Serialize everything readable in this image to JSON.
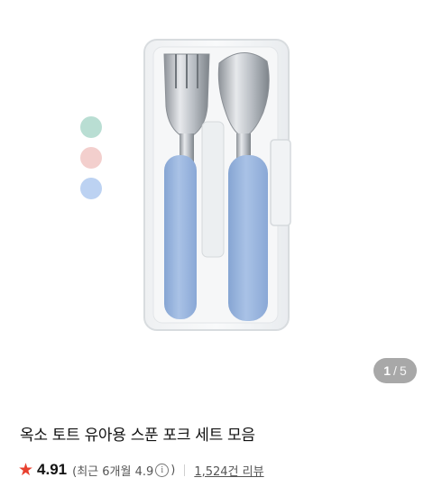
{
  "product": {
    "title": "옥소 토트 유아용 스푼 포크 세트 모음",
    "image_alt": "OXO tot spoon and fork set in case"
  },
  "color_options": [
    {
      "name": "mint",
      "color": "#b9ded3"
    },
    {
      "name": "pink",
      "color": "#f3cfcd"
    },
    {
      "name": "blue",
      "color": "#bcd2f2"
    }
  ],
  "pager": {
    "current": "1",
    "separator": "/",
    "total": "5"
  },
  "rating": {
    "icon": "star-icon",
    "star_color": "#e8402f",
    "value": "4.91",
    "recent_open": "(최근 6개월 4.9",
    "recent_close": ")",
    "reviews": "1,524건 리뷰"
  },
  "colors": {
    "handle": "#9bb8e0",
    "pager_bg": "#a8a8a8"
  }
}
